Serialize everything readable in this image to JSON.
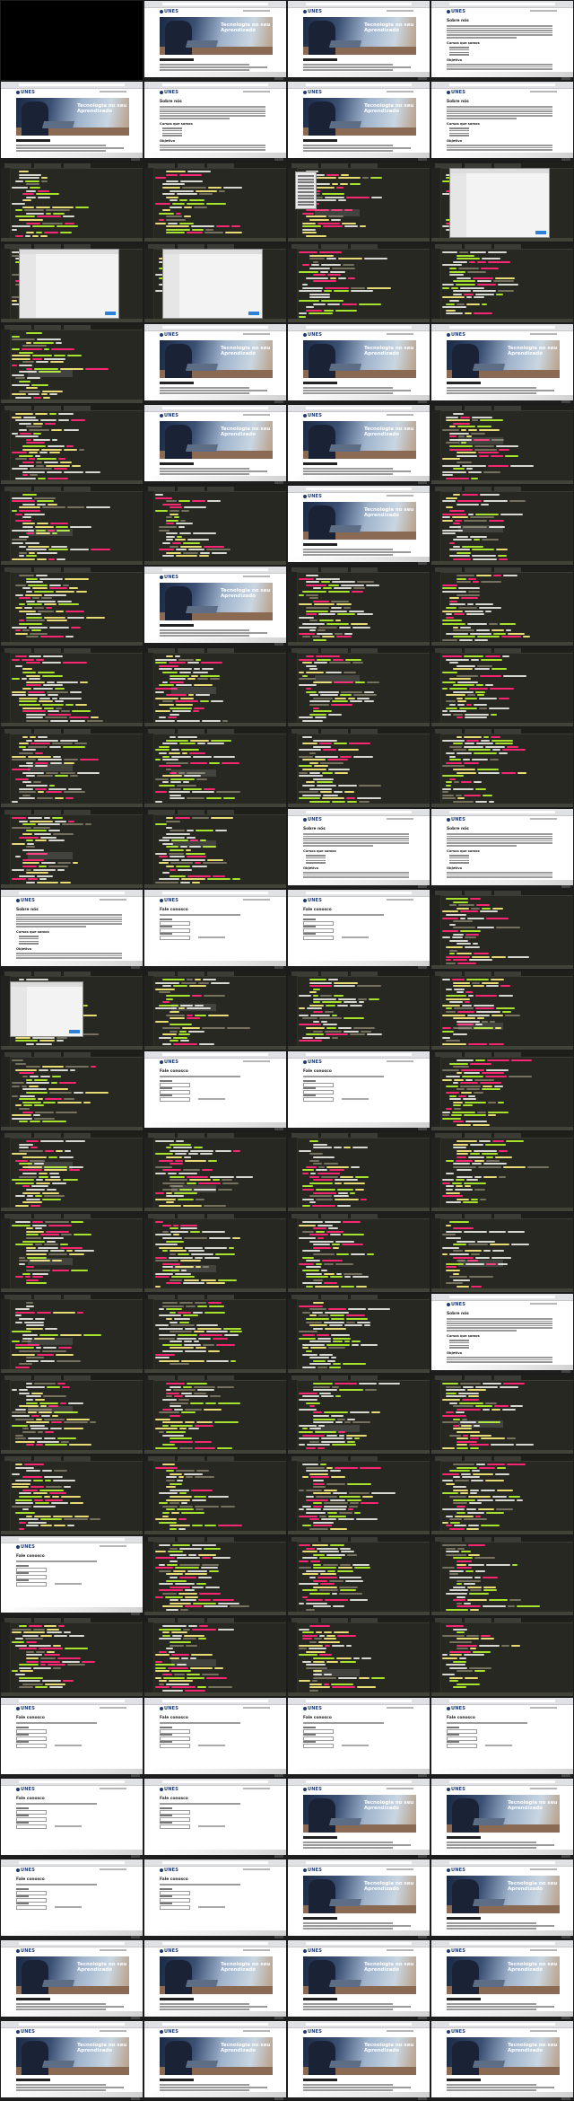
{
  "window": {
    "description_count_cols": 4,
    "description_count_rows": 25
  },
  "site": {
    "logo_text": "UNES",
    "hero_text": "Tecnologia no seu Aprendizado",
    "section_titles": [
      "Sobre nós",
      "Cursos que somos",
      "Objetivo",
      "Fale conosco"
    ],
    "form_title": "Fale conosco"
  },
  "colors": {
    "editor_bg": "#272822",
    "tag": "#f92672",
    "attr": "#a6e22e",
    "string": "#e6db74",
    "brand": "#1f3a72"
  },
  "tiles": [
    "black",
    "hero",
    "hero",
    "text",
    "hero",
    "text",
    "hero",
    "text",
    "code",
    "code",
    "code-menu",
    "dialog",
    "dialog",
    "dialog",
    "code",
    "code",
    "code",
    "hero",
    "hero",
    "hero",
    "code",
    "hero",
    "hero",
    "code",
    "code",
    "code",
    "hero",
    "code",
    "code",
    "hero",
    "code",
    "code",
    "code",
    "code",
    "code",
    "code",
    "code",
    "code",
    "code",
    "code",
    "code",
    "code",
    "text",
    "text",
    "text",
    "form",
    "form",
    "code",
    "code-dialog",
    "code",
    "code",
    "code",
    "code",
    "form",
    "form",
    "code",
    "code",
    "code",
    "code",
    "code",
    "code",
    "code",
    "code",
    "code",
    "code",
    "code",
    "code",
    "text",
    "code",
    "code",
    "code",
    "code",
    "code",
    "code",
    "code",
    "code",
    "form",
    "code",
    "code",
    "code",
    "code",
    "code",
    "code",
    "code",
    "form",
    "form",
    "form",
    "form",
    "form",
    "form",
    "hero",
    "hero",
    "form",
    "form",
    "hero",
    "hero",
    "hero",
    "hero",
    "hero",
    "hero",
    "hero",
    "hero",
    "hero",
    "hero"
  ]
}
